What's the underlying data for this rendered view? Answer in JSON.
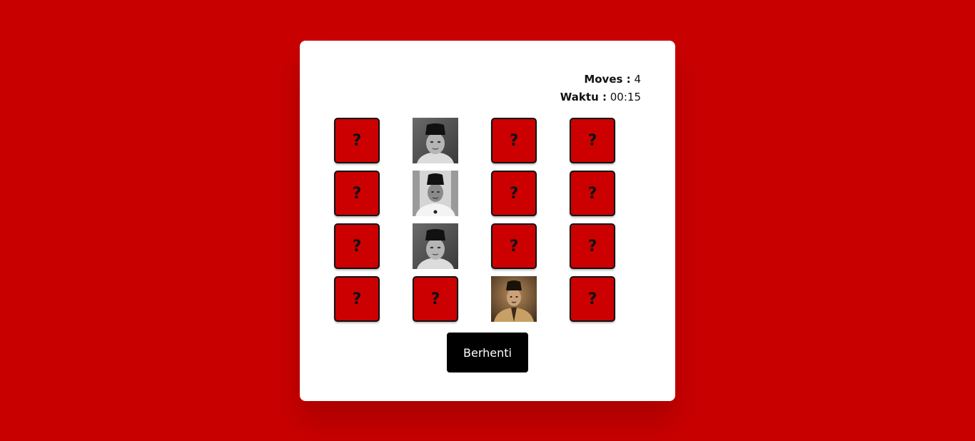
{
  "stats": {
    "moves_label": "Moves :",
    "moves_value": "4",
    "time_label": "Waktu :",
    "time_value": "00:15"
  },
  "card_back_symbol": "?",
  "cards": [
    {
      "state": "hidden"
    },
    {
      "state": "open",
      "portrait": "portrait-a"
    },
    {
      "state": "hidden"
    },
    {
      "state": "hidden"
    },
    {
      "state": "hidden"
    },
    {
      "state": "open",
      "portrait": "portrait-b"
    },
    {
      "state": "hidden"
    },
    {
      "state": "hidden"
    },
    {
      "state": "hidden"
    },
    {
      "state": "open",
      "portrait": "portrait-a"
    },
    {
      "state": "hidden"
    },
    {
      "state": "hidden"
    },
    {
      "state": "hidden"
    },
    {
      "state": "hidden"
    },
    {
      "state": "open",
      "portrait": "portrait-c"
    },
    {
      "state": "hidden"
    }
  ],
  "colors": {
    "background": "#c90000",
    "card_back": "#cc0000",
    "button": "#000000"
  },
  "stop_button_label": "Berhenti"
}
